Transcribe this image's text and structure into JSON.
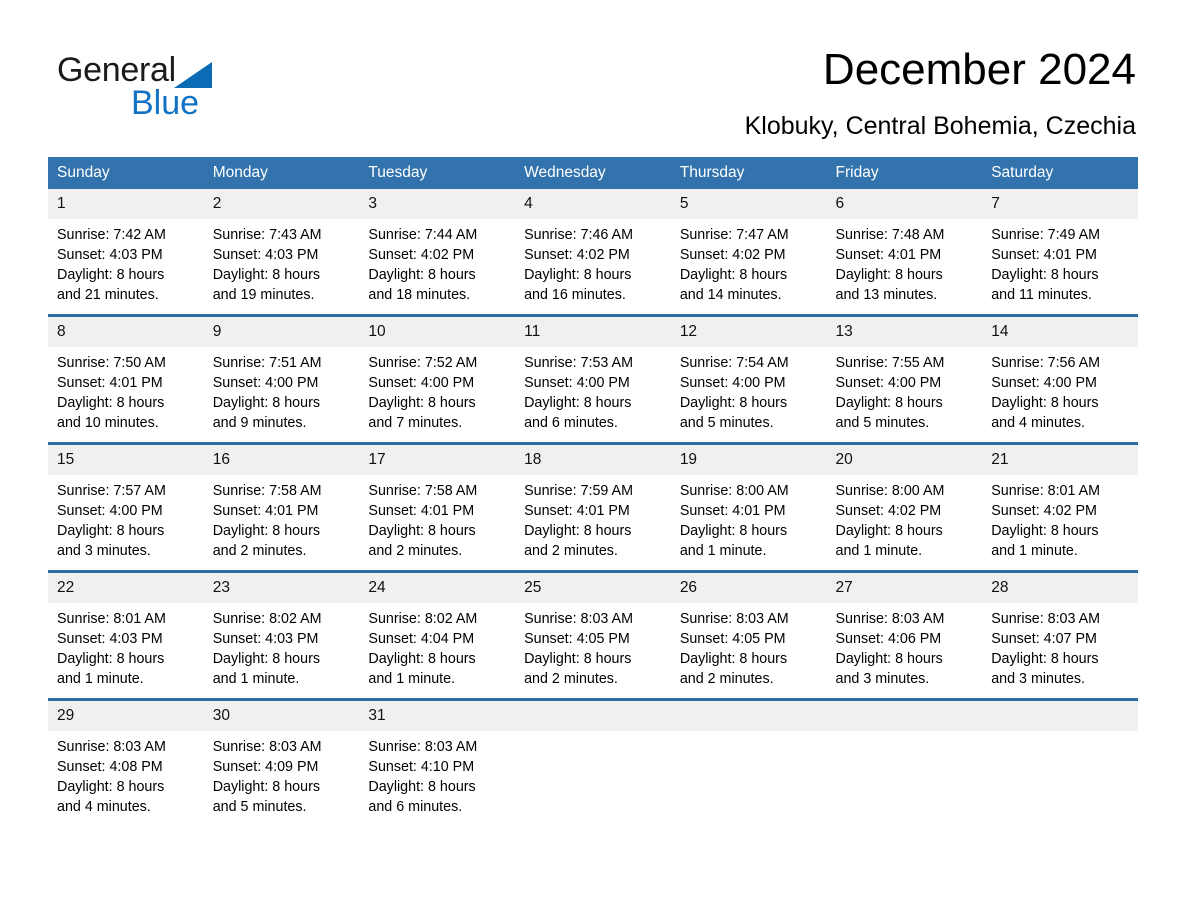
{
  "logo": {
    "word1": "General",
    "word2": "Blue",
    "triangle_color": "#0b6cb5",
    "word2_color": "#1273c4"
  },
  "header": {
    "title": "December 2024",
    "subtitle": "Klobuky, Central Bohemia, Czechia"
  },
  "theme": {
    "header_blue": "#3273ae",
    "row_rule_blue": "#2e6da4",
    "daynum_bg": "#f0f0f0"
  },
  "calendar": {
    "weekday_headers": [
      "Sunday",
      "Monday",
      "Tuesday",
      "Wednesday",
      "Thursday",
      "Friday",
      "Saturday"
    ],
    "weeks": [
      [
        {
          "day": "1",
          "info": "Sunrise: 7:42 AM\nSunset: 4:03 PM\nDaylight: 8 hours\nand 21 minutes."
        },
        {
          "day": "2",
          "info": "Sunrise: 7:43 AM\nSunset: 4:03 PM\nDaylight: 8 hours\nand 19 minutes."
        },
        {
          "day": "3",
          "info": "Sunrise: 7:44 AM\nSunset: 4:02 PM\nDaylight: 8 hours\nand 18 minutes."
        },
        {
          "day": "4",
          "info": "Sunrise: 7:46 AM\nSunset: 4:02 PM\nDaylight: 8 hours\nand 16 minutes."
        },
        {
          "day": "5",
          "info": "Sunrise: 7:47 AM\nSunset: 4:02 PM\nDaylight: 8 hours\nand 14 minutes."
        },
        {
          "day": "6",
          "info": "Sunrise: 7:48 AM\nSunset: 4:01 PM\nDaylight: 8 hours\nand 13 minutes."
        },
        {
          "day": "7",
          "info": "Sunrise: 7:49 AM\nSunset: 4:01 PM\nDaylight: 8 hours\nand 11 minutes."
        }
      ],
      [
        {
          "day": "8",
          "info": "Sunrise: 7:50 AM\nSunset: 4:01 PM\nDaylight: 8 hours\nand 10 minutes."
        },
        {
          "day": "9",
          "info": "Sunrise: 7:51 AM\nSunset: 4:00 PM\nDaylight: 8 hours\nand 9 minutes."
        },
        {
          "day": "10",
          "info": "Sunrise: 7:52 AM\nSunset: 4:00 PM\nDaylight: 8 hours\nand 7 minutes."
        },
        {
          "day": "11",
          "info": "Sunrise: 7:53 AM\nSunset: 4:00 PM\nDaylight: 8 hours\nand 6 minutes."
        },
        {
          "day": "12",
          "info": "Sunrise: 7:54 AM\nSunset: 4:00 PM\nDaylight: 8 hours\nand 5 minutes."
        },
        {
          "day": "13",
          "info": "Sunrise: 7:55 AM\nSunset: 4:00 PM\nDaylight: 8 hours\nand 5 minutes."
        },
        {
          "day": "14",
          "info": "Sunrise: 7:56 AM\nSunset: 4:00 PM\nDaylight: 8 hours\nand 4 minutes."
        }
      ],
      [
        {
          "day": "15",
          "info": "Sunrise: 7:57 AM\nSunset: 4:00 PM\nDaylight: 8 hours\nand 3 minutes."
        },
        {
          "day": "16",
          "info": "Sunrise: 7:58 AM\nSunset: 4:01 PM\nDaylight: 8 hours\nand 2 minutes."
        },
        {
          "day": "17",
          "info": "Sunrise: 7:58 AM\nSunset: 4:01 PM\nDaylight: 8 hours\nand 2 minutes."
        },
        {
          "day": "18",
          "info": "Sunrise: 7:59 AM\nSunset: 4:01 PM\nDaylight: 8 hours\nand 2 minutes."
        },
        {
          "day": "19",
          "info": "Sunrise: 8:00 AM\nSunset: 4:01 PM\nDaylight: 8 hours\nand 1 minute."
        },
        {
          "day": "20",
          "info": "Sunrise: 8:00 AM\nSunset: 4:02 PM\nDaylight: 8 hours\nand 1 minute."
        },
        {
          "day": "21",
          "info": "Sunrise: 8:01 AM\nSunset: 4:02 PM\nDaylight: 8 hours\nand 1 minute."
        }
      ],
      [
        {
          "day": "22",
          "info": "Sunrise: 8:01 AM\nSunset: 4:03 PM\nDaylight: 8 hours\nand 1 minute."
        },
        {
          "day": "23",
          "info": "Sunrise: 8:02 AM\nSunset: 4:03 PM\nDaylight: 8 hours\nand 1 minute."
        },
        {
          "day": "24",
          "info": "Sunrise: 8:02 AM\nSunset: 4:04 PM\nDaylight: 8 hours\nand 1 minute."
        },
        {
          "day": "25",
          "info": "Sunrise: 8:03 AM\nSunset: 4:05 PM\nDaylight: 8 hours\nand 2 minutes."
        },
        {
          "day": "26",
          "info": "Sunrise: 8:03 AM\nSunset: 4:05 PM\nDaylight: 8 hours\nand 2 minutes."
        },
        {
          "day": "27",
          "info": "Sunrise: 8:03 AM\nSunset: 4:06 PM\nDaylight: 8 hours\nand 3 minutes."
        },
        {
          "day": "28",
          "info": "Sunrise: 8:03 AM\nSunset: 4:07 PM\nDaylight: 8 hours\nand 3 minutes."
        }
      ],
      [
        {
          "day": "29",
          "info": "Sunrise: 8:03 AM\nSunset: 4:08 PM\nDaylight: 8 hours\nand 4 minutes."
        },
        {
          "day": "30",
          "info": "Sunrise: 8:03 AM\nSunset: 4:09 PM\nDaylight: 8 hours\nand 5 minutes."
        },
        {
          "day": "31",
          "info": "Sunrise: 8:03 AM\nSunset: 4:10 PM\nDaylight: 8 hours\nand 6 minutes."
        },
        {
          "day": "",
          "info": ""
        },
        {
          "day": "",
          "info": ""
        },
        {
          "day": "",
          "info": ""
        },
        {
          "day": "",
          "info": ""
        }
      ]
    ]
  }
}
